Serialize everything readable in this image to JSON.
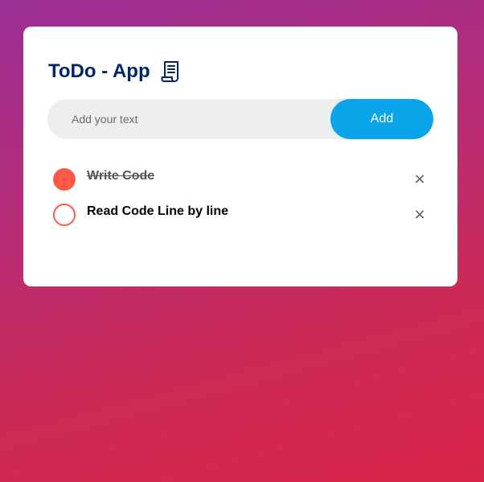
{
  "app": {
    "title": "ToDo - App",
    "title_icon": "notepad-icon"
  },
  "input": {
    "placeholder": "Add your text",
    "value": ""
  },
  "add_button": {
    "label": "Add"
  },
  "tasks": [
    {
      "text": "Write Code",
      "checked": true,
      "remove_glyph": "×"
    },
    {
      "text": "Read Code Line by line",
      "checked": false,
      "remove_glyph": "×"
    }
  ],
  "colors": {
    "title": "#002765",
    "accent_button": "#0aa5e9",
    "check": "#ff5945",
    "input_bg": "#edeef0"
  }
}
